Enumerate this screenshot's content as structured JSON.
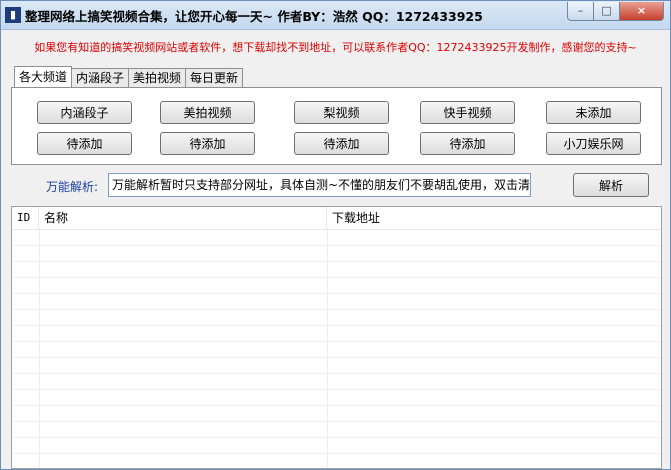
{
  "window": {
    "title": "整理网络上搞笑视频合集，让您开心每一天~ 作者BY：浩然 QQ：1272433925",
    "app_icon": "app-icon",
    "controls": {
      "minimize": "–",
      "maximize": "□",
      "close": "×"
    }
  },
  "notice": "如果您有知道的搞笑视频网站或者软件，想下载却找不到地址，可以联系作者QQ：1272433925开发制作，感谢您的支持~",
  "tabs": [
    {
      "label": "各大频道",
      "active": true
    },
    {
      "label": "内涵段子",
      "active": false
    },
    {
      "label": "美拍视频",
      "active": false
    },
    {
      "label": "每日更新",
      "active": false
    }
  ],
  "channel_buttons": {
    "row1": [
      "内涵段子",
      "美拍视频",
      "梨视频",
      "快手视频",
      "未添加"
    ],
    "row2": [
      "待添加",
      "待添加",
      "待添加",
      "待添加",
      "小刀娱乐网"
    ]
  },
  "parse": {
    "label": "万能解析:",
    "input_value": "万能解析暂时只支持部分网址，具体自测~不懂的朋友们不要胡乱使用，双击清理~",
    "button": "解析"
  },
  "list": {
    "columns": [
      "ID",
      "名称",
      "下载地址"
    ],
    "rows": []
  },
  "colors": {
    "notice": "#e00000",
    "parse_label": "#1a3ea8",
    "close_button": "#c7402b"
  }
}
